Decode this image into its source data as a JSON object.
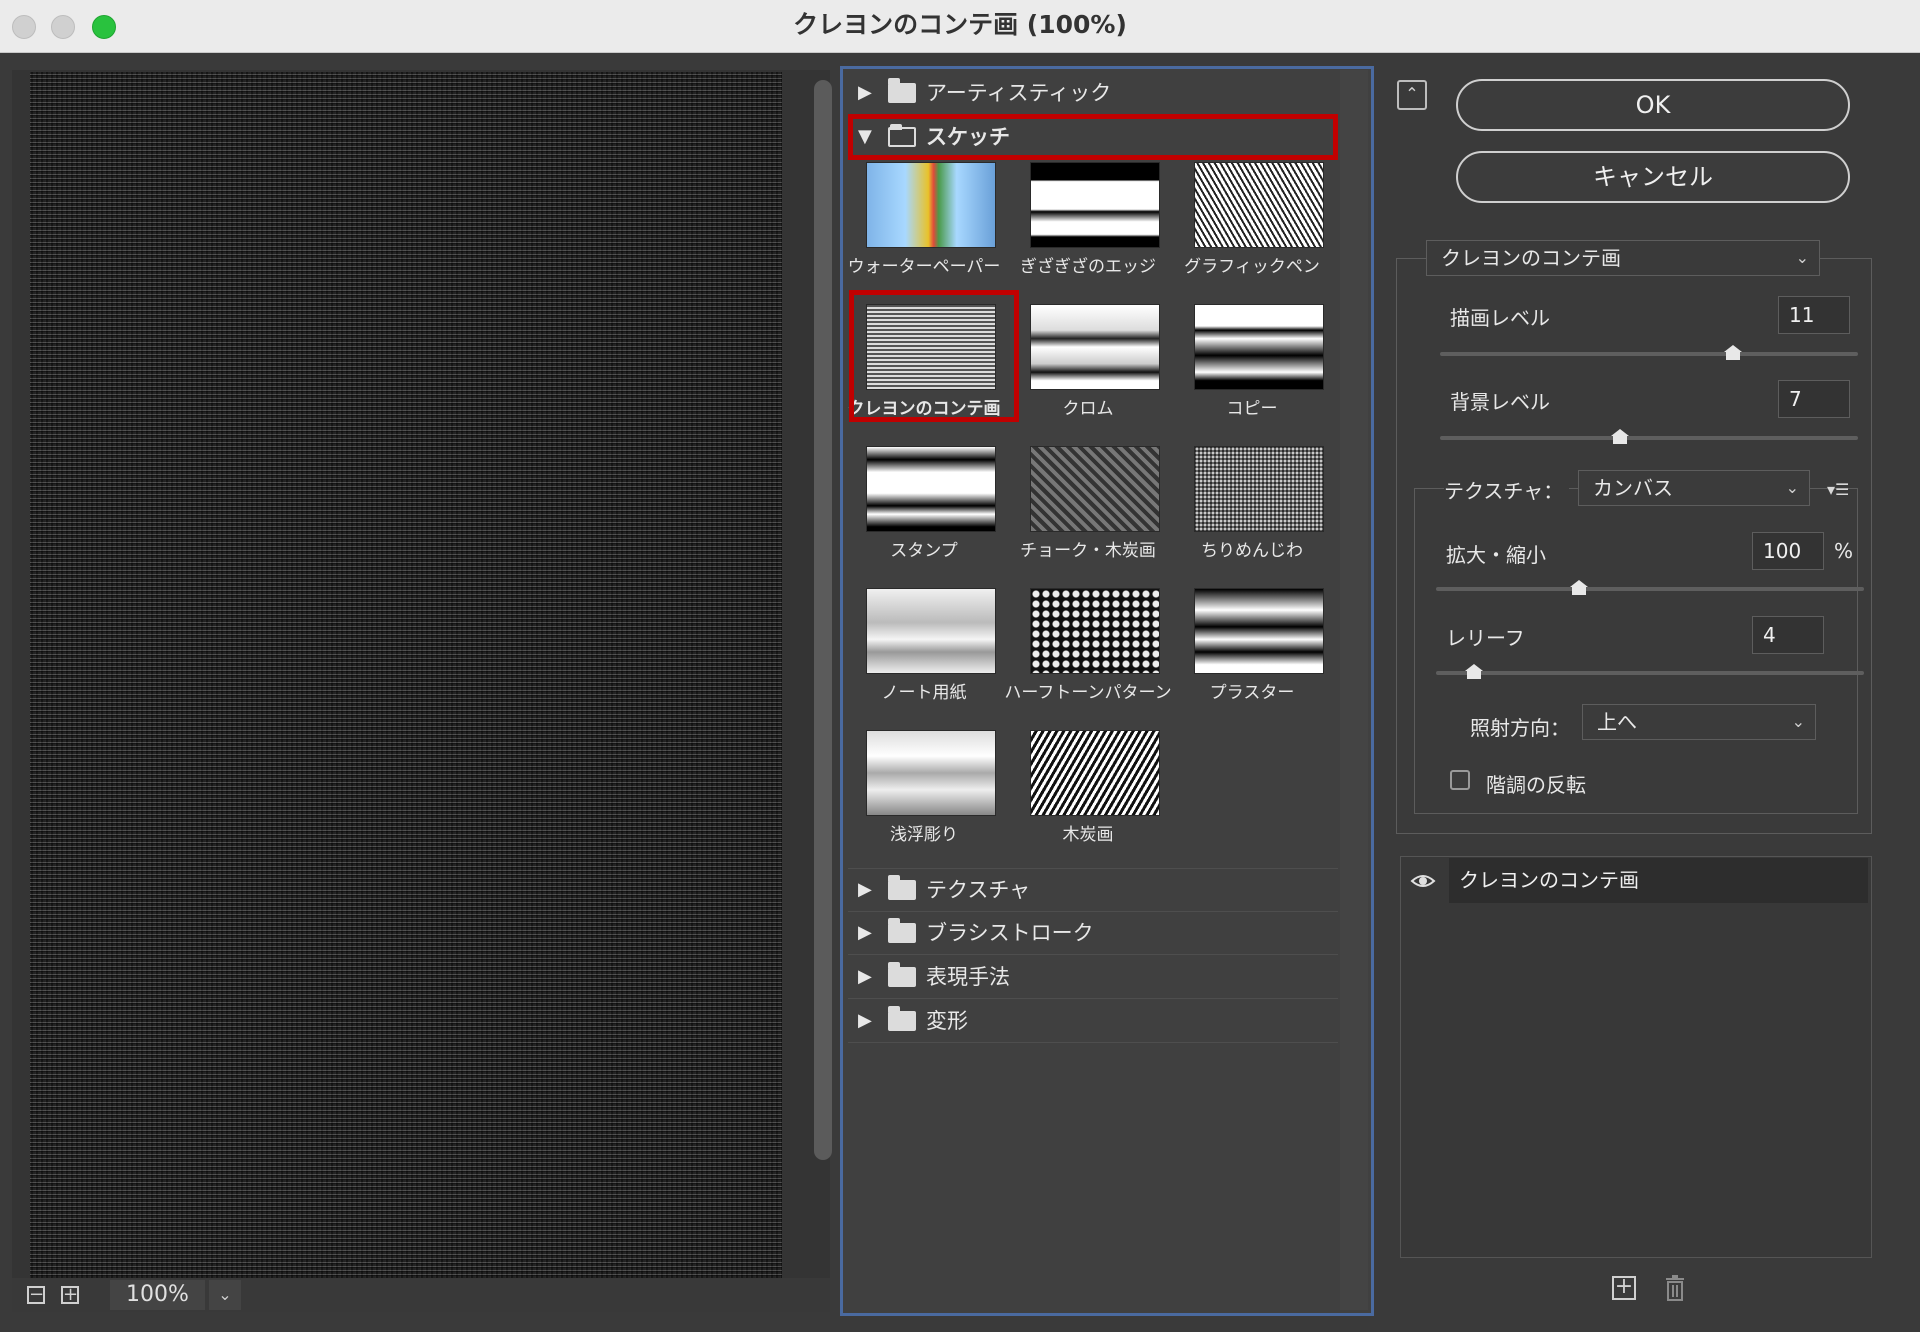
{
  "window": {
    "title": "クレヨンのコンテ画 (100%)"
  },
  "preview": {
    "zoom": "100%"
  },
  "gallery": {
    "folders_top": [
      {
        "label": "アーティスティック",
        "expanded": false
      },
      {
        "label": "スケッチ",
        "expanded": true
      }
    ],
    "thumbnails": [
      {
        "label": "ウォーターペーパー"
      },
      {
        "label": "ぎざぎざのエッジ"
      },
      {
        "label": "グラフィックペン"
      },
      {
        "label": "クレヨンのコンテ画",
        "selected": true
      },
      {
        "label": "クロム"
      },
      {
        "label": "コピー"
      },
      {
        "label": "スタンプ"
      },
      {
        "label": "チョーク・木炭画"
      },
      {
        "label": "ちりめんじわ"
      },
      {
        "label": "ノート用紙"
      },
      {
        "label": "ハーフトーンパターン"
      },
      {
        "label": "プラスター"
      },
      {
        "label": "浅浮彫り"
      },
      {
        "label": "木炭画"
      }
    ],
    "folders_bottom": [
      {
        "label": "テクスチャ"
      },
      {
        "label": "ブラシストローク"
      },
      {
        "label": "表現手法"
      },
      {
        "label": "変形"
      }
    ]
  },
  "buttons": {
    "ok": "OK",
    "cancel": "キャンセル"
  },
  "settings": {
    "filter_select": "クレヨンのコンテ画",
    "foreground_level": {
      "label": "描画レベル",
      "value": "11",
      "fraction": 0.7
    },
    "background_level": {
      "label": "背景レベル",
      "value": "7",
      "fraction": 0.43
    },
    "texture": {
      "label": "テクスチャ：",
      "value": "カンバス"
    },
    "scaling": {
      "label": "拡大・縮小",
      "value": "100",
      "unit": "%",
      "fraction": 0.33
    },
    "relief": {
      "label": "レリーフ",
      "value": "4",
      "fraction": 0.09
    },
    "light": {
      "label": "照射方向：",
      "value": "上へ"
    },
    "invert": {
      "label": "階調の反転",
      "checked": false
    }
  },
  "layers": [
    {
      "name": "クレヨンのコンテ画"
    }
  ],
  "colors": {
    "highlight": "#c00000",
    "gallery_border": "#4a6aa0"
  }
}
